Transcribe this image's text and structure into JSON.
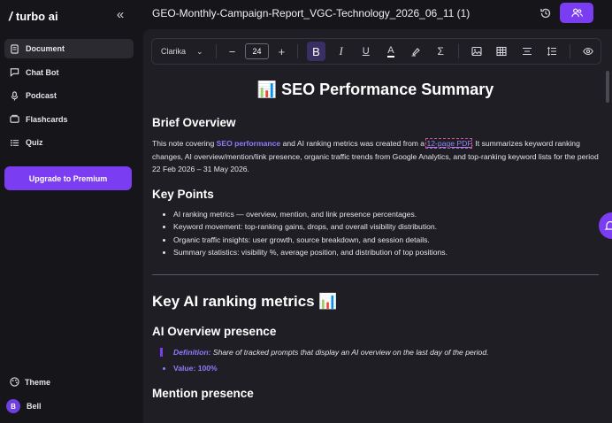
{
  "app": {
    "brand": "turbo ai"
  },
  "sidebar": {
    "items": [
      {
        "label": "Document",
        "icon": "document-icon",
        "active": true
      },
      {
        "label": "Chat Bot",
        "icon": "chat-icon",
        "active": false
      },
      {
        "label": "Podcast",
        "icon": "microphone-icon",
        "active": false
      },
      {
        "label": "Flashcards",
        "icon": "cards-icon",
        "active": false
      },
      {
        "label": "Quiz",
        "icon": "list-icon",
        "active": false
      }
    ],
    "upgrade_label": "Upgrade to Premium",
    "theme_label": "Theme",
    "user": {
      "initial": "B",
      "name": "Bell"
    }
  },
  "header": {
    "title": "GEO-Monthly-Campaign-Report_VGC-Technology_2026_06_11 (1)"
  },
  "toolbar": {
    "font": "Clarika",
    "font_size": "24"
  },
  "document": {
    "title": "📊 SEO Performance Summary",
    "brief_heading": "Brief Overview",
    "brief": {
      "p1": "This note covering ",
      "highlight": "SEO performance",
      "p2": " and AI ranking metrics was created from a ",
      "link": "12-page PDF",
      "p3": ". It summarizes keyword ranking changes, AI overview/mention/link presence, organic traffic trends from Google Analytics, and top-ranking keyword lists for the period 22 Feb 2026 – 31 May 2026."
    },
    "points_heading": "Key Points",
    "points": [
      "AI ranking metrics — overview, mention, and link presence percentages.",
      "Keyword movement: top-ranking gains, drops, and overall visibility distribution.",
      "Organic traffic insights: user growth, source breakdown, and session details.",
      "Summary statistics: visibility %, average position, and distribution of top positions."
    ],
    "metrics_heading": "Key AI ranking metrics 📊",
    "ai_overview_heading": "AI Overview presence",
    "definition_label": "Definition:",
    "definition_text": " Share of tracked prompts that display an AI overview on the last day of the period.",
    "value_line": "Value: 100%",
    "mention_heading": "Mention presence"
  },
  "colors": {
    "accent": "#7b3df2",
    "link": "#8f7bff",
    "background": "#16151a"
  }
}
